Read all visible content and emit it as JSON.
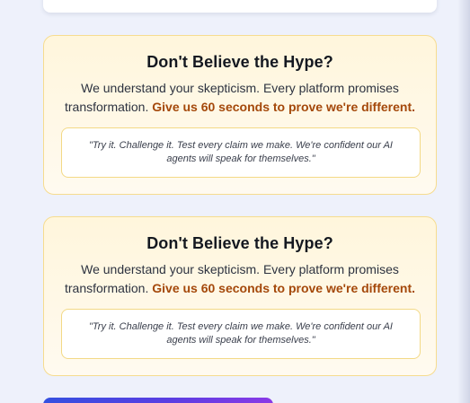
{
  "cards": [
    {
      "title": "Don't Believe the Hype?",
      "body": "We understand your skepticism. Every platform promises transformation. ",
      "highlight": "Give us 60 seconds to prove we're different.",
      "quote": "\"Try it. Challenge it. Test every claim we make. We're confident our AI agents will speak for themselves.\""
    },
    {
      "title": "Don't Believe the Hype?",
      "body": "We understand your skepticism. Every platform promises transformation. ",
      "highlight": "Give us 60 seconds to prove we're different.",
      "quote": "\"Try it. Challenge it. Test every claim we make. We're confident our AI agents will speak for themselves.\""
    }
  ],
  "colors": {
    "page_bg": "#eef1fb",
    "card_bg": "#fff6dc",
    "card_border": "#f6dc8f",
    "highlight": "#a4480a",
    "cta_gradient_start": "#3450e0",
    "cta_gradient_end": "#8a3ae6"
  }
}
